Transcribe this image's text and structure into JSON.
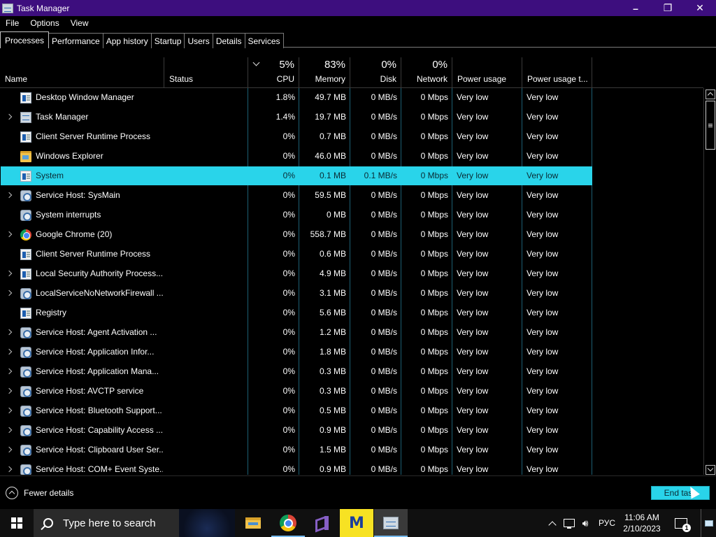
{
  "window": {
    "title": "Task Manager",
    "minimize": "–",
    "maximize": "❐",
    "close": "✕"
  },
  "menu": [
    "File",
    "Options",
    "View"
  ],
  "tabs": [
    "Processes",
    "Performance",
    "App history",
    "Startup",
    "Users",
    "Details",
    "Services"
  ],
  "columns": {
    "name": {
      "label": "Name"
    },
    "status": {
      "label": "Status"
    },
    "cpu": {
      "label": "CPU",
      "pct": "5%"
    },
    "memory": {
      "label": "Memory",
      "pct": "83%"
    },
    "disk": {
      "label": "Disk",
      "pct": "0%"
    },
    "network": {
      "label": "Network",
      "pct": "0%"
    },
    "power": {
      "label": "Power usage"
    },
    "power_trend": {
      "label": "Power usage t..."
    }
  },
  "processes": [
    {
      "name": "Desktop Window Manager",
      "cpu": "1.8%",
      "memory": "49.7 MB",
      "disk": "0 MB/s",
      "network": "0 Mbps",
      "power": "Very low",
      "power_trend": "Very low",
      "expandable": false,
      "icon": "window-icon"
    },
    {
      "name": "Task Manager",
      "cpu": "1.4%",
      "memory": "19.7 MB",
      "disk": "0 MB/s",
      "network": "0 Mbps",
      "power": "Very low",
      "power_trend": "Very low",
      "expandable": true,
      "icon": "task-manager-icon"
    },
    {
      "name": "Client Server Runtime Process",
      "cpu": "0%",
      "memory": "0.7 MB",
      "disk": "0 MB/s",
      "network": "0 Mbps",
      "power": "Very low",
      "power_trend": "Very low",
      "expandable": false,
      "icon": "window-icon"
    },
    {
      "name": "Windows Explorer",
      "cpu": "0%",
      "memory": "46.0 MB",
      "disk": "0 MB/s",
      "network": "0 Mbps",
      "power": "Very low",
      "power_trend": "Very low",
      "expandable": false,
      "icon": "folder-icon"
    },
    {
      "name": "System",
      "cpu": "0%",
      "memory": "0.1 MB",
      "disk": "0.1 MB/s",
      "network": "0 Mbps",
      "power": "Very low",
      "power_trend": "Very low",
      "expandable": false,
      "icon": "window-icon",
      "selected": true
    },
    {
      "name": "Service Host: SysMain",
      "cpu": "0%",
      "memory": "59.5 MB",
      "disk": "0 MB/s",
      "network": "0 Mbps",
      "power": "Very low",
      "power_trend": "Very low",
      "expandable": true,
      "icon": "gear-icon"
    },
    {
      "name": "System interrupts",
      "cpu": "0%",
      "memory": "0 MB",
      "disk": "0 MB/s",
      "network": "0 Mbps",
      "power": "Very low",
      "power_trend": "Very low",
      "expandable": false,
      "icon": "gear-icon"
    },
    {
      "name": "Google Chrome (20)",
      "cpu": "0%",
      "memory": "558.7 MB",
      "disk": "0 MB/s",
      "network": "0 Mbps",
      "power": "Very low",
      "power_trend": "Very low",
      "expandable": true,
      "icon": "chrome-icon"
    },
    {
      "name": "Client Server Runtime Process",
      "cpu": "0%",
      "memory": "0.6 MB",
      "disk": "0 MB/s",
      "network": "0 Mbps",
      "power": "Very low",
      "power_trend": "Very low",
      "expandable": false,
      "icon": "window-icon"
    },
    {
      "name": "Local Security Authority Process...",
      "cpu": "0%",
      "memory": "4.9 MB",
      "disk": "0 MB/s",
      "network": "0 Mbps",
      "power": "Very low",
      "power_trend": "Very low",
      "expandable": true,
      "icon": "window-icon"
    },
    {
      "name": "LocalServiceNoNetworkFirewall ...",
      "cpu": "0%",
      "memory": "3.1 MB",
      "disk": "0 MB/s",
      "network": "0 Mbps",
      "power": "Very low",
      "power_trend": "Very low",
      "expandable": true,
      "icon": "gear-icon"
    },
    {
      "name": "Registry",
      "cpu": "0%",
      "memory": "5.6 MB",
      "disk": "0 MB/s",
      "network": "0 Mbps",
      "power": "Very low",
      "power_trend": "Very low",
      "expandable": false,
      "icon": "window-icon"
    },
    {
      "name": "Service Host: Agent Activation ...",
      "cpu": "0%",
      "memory": "1.2 MB",
      "disk": "0 MB/s",
      "network": "0 Mbps",
      "power": "Very low",
      "power_trend": "Very low",
      "expandable": true,
      "icon": "gear-icon"
    },
    {
      "name": "Service Host: Application Infor...",
      "cpu": "0%",
      "memory": "1.8 MB",
      "disk": "0 MB/s",
      "network": "0 Mbps",
      "power": "Very low",
      "power_trend": "Very low",
      "expandable": true,
      "icon": "gear-icon"
    },
    {
      "name": "Service Host: Application Mana...",
      "cpu": "0%",
      "memory": "0.3 MB",
      "disk": "0 MB/s",
      "network": "0 Mbps",
      "power": "Very low",
      "power_trend": "Very low",
      "expandable": true,
      "icon": "gear-icon"
    },
    {
      "name": "Service Host: AVCTP service",
      "cpu": "0%",
      "memory": "0.3 MB",
      "disk": "0 MB/s",
      "network": "0 Mbps",
      "power": "Very low",
      "power_trend": "Very low",
      "expandable": true,
      "icon": "gear-icon"
    },
    {
      "name": "Service Host: Bluetooth Support...",
      "cpu": "0%",
      "memory": "0.5 MB",
      "disk": "0 MB/s",
      "network": "0 Mbps",
      "power": "Very low",
      "power_trend": "Very low",
      "expandable": true,
      "icon": "gear-icon"
    },
    {
      "name": "Service Host: Capability Access ...",
      "cpu": "0%",
      "memory": "0.9 MB",
      "disk": "0 MB/s",
      "network": "0 Mbps",
      "power": "Very low",
      "power_trend": "Very low",
      "expandable": true,
      "icon": "gear-icon"
    },
    {
      "name": "Service Host: Clipboard User Ser...",
      "cpu": "0%",
      "memory": "1.5 MB",
      "disk": "0 MB/s",
      "network": "0 Mbps",
      "power": "Very low",
      "power_trend": "Very low",
      "expandable": true,
      "icon": "gear-icon"
    },
    {
      "name": "Service Host: COM+ Event Syste...",
      "cpu": "0%",
      "memory": "0.9 MB",
      "disk": "0 MB/s",
      "network": "0 Mbps",
      "power": "Very low",
      "power_trend": "Very low",
      "expandable": true,
      "icon": "gear-icon"
    }
  ],
  "footer": {
    "fewer_details": "Fewer details",
    "end_task": "End task"
  },
  "taskbar": {
    "search_placeholder": "Type here to search",
    "apps": [
      "file-explorer-icon",
      "chrome-icon",
      "visual-studio-icon",
      "malwarebytes-icon",
      "task-manager-icon"
    ],
    "malwarebytes_glyph": "M",
    "volume_glyph": "🔊︎",
    "language": "РУС",
    "time": "11:06 AM",
    "date": "2/10/2023",
    "notification_count": "1"
  },
  "colors": {
    "titlebar": "#3d0e7e",
    "selection": "#29d4ea",
    "background": "#000000"
  }
}
